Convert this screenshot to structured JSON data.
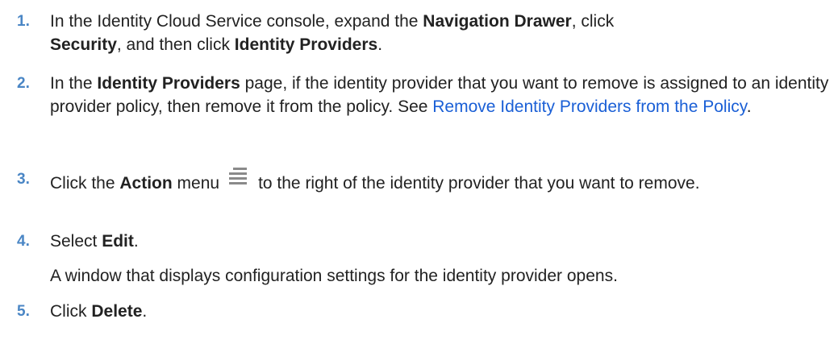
{
  "steps": [
    {
      "number": "1.",
      "p1": "In the Identity Cloud Service console, expand the ",
      "b1": "Navigation Drawer",
      "p2": ", click ",
      "b2": "Security",
      "p3": ", and then click ",
      "b3": "Identity Providers",
      "p4": "."
    },
    {
      "number": "2.",
      "p1": "In the ",
      "b1": "Identity Providers",
      "p2": " page, if the identity provider that you want to remove is assigned to an identity provider policy, then remove it from the policy. See ",
      "link": "Remove Identity Providers from the Policy",
      "p3": "."
    },
    {
      "number": "3.",
      "p1": "Click the ",
      "b1": "Action",
      "p2": " menu",
      "icon": "action-menu-icon",
      "p3": "to the right of the identity provider that you want to remove."
    },
    {
      "number": "4.",
      "p1": "Select ",
      "b1": "Edit",
      "p2": ".",
      "note": "A window that displays configuration settings for the identity provider opens."
    },
    {
      "number": "5.",
      "p1": "Click ",
      "b1": "Delete",
      "p2": "."
    }
  ],
  "colors": {
    "text": "#222222",
    "step_number": "#4a86c5",
    "link": "#1a5fd6",
    "icon": "#8a8a8a"
  }
}
